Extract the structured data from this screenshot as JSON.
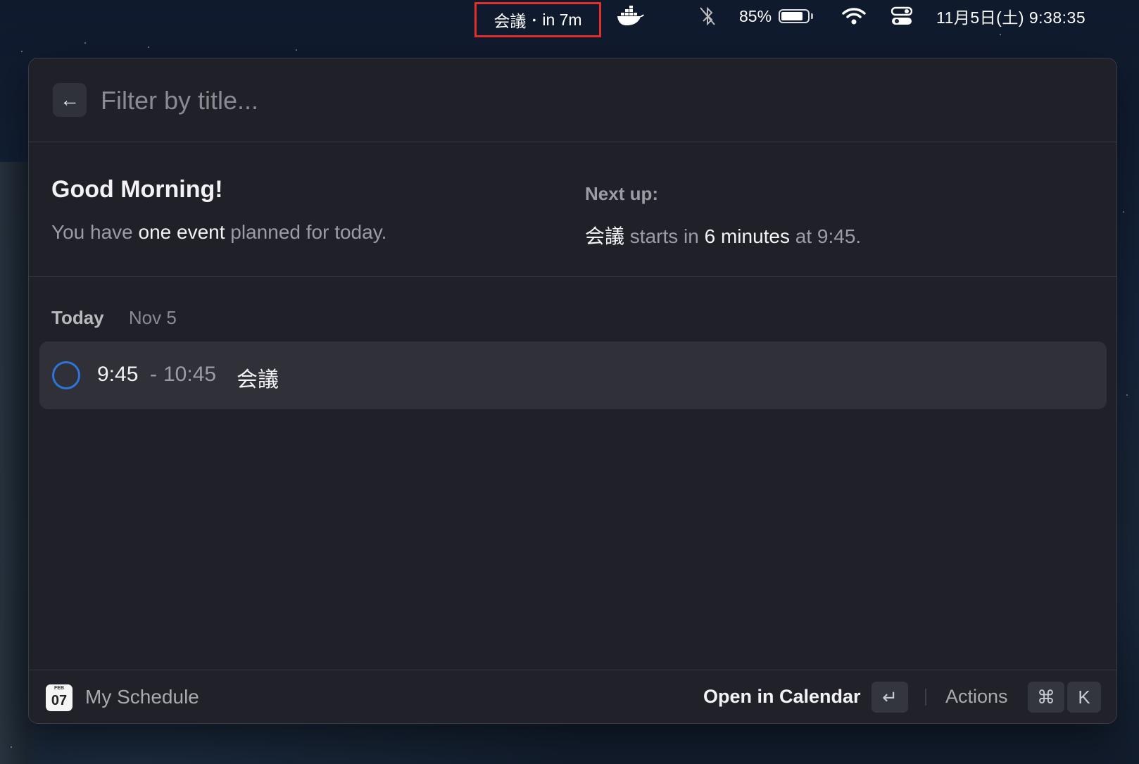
{
  "menubar": {
    "event_title": "会議",
    "event_separator": "•",
    "event_countdown": "in 7m",
    "battery_percent": "85%",
    "clock": "11月5日(土)  9:38:35",
    "icons": [
      "docker-icon",
      "bluetooth-off-icon",
      "battery-icon",
      "wifi-icon",
      "control-center-icon"
    ]
  },
  "search": {
    "placeholder": "Filter by title...",
    "back_icon": "arrow-left-icon"
  },
  "summary": {
    "greeting": "Good Morning!",
    "text_prefix": "You have ",
    "text_highlight": "one event",
    "text_suffix": " planned for today.",
    "next_label": "Next up:",
    "next_event": "会議",
    "next_mid": " starts in ",
    "next_time_until": "6 minutes",
    "next_at": " at 9:45."
  },
  "section": {
    "title": "Today",
    "date": "Nov 5"
  },
  "events": [
    {
      "start": "9:45",
      "separator": "-",
      "end": "10:45",
      "title": "会議",
      "status_color": "#2e74d9"
    }
  ],
  "footer": {
    "icon_month": "FEB",
    "icon_day": "07",
    "title": "My Schedule",
    "primary_action": "Open in Calendar",
    "primary_shortcut": "↵",
    "actions_label": "Actions",
    "actions_shortcut_1": "⌘",
    "actions_shortcut_2": "K"
  },
  "colors": {
    "accent": "#2e74d9",
    "panel_bg": "#1f2028",
    "highlight_box": "#e0312b"
  }
}
